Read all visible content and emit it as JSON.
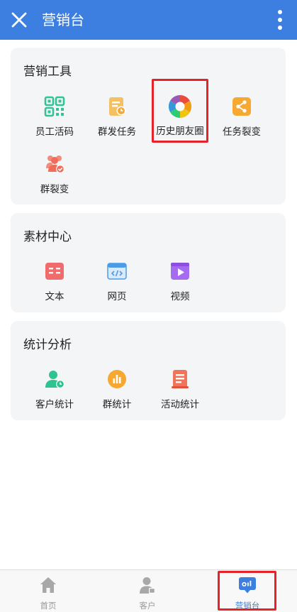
{
  "header": {
    "title": "营销台",
    "close_icon": "close-icon",
    "more_icon": "more-vertical-icon"
  },
  "sections": [
    {
      "title": "营销工具",
      "items": [
        {
          "label": "员工活码",
          "icon": "qr-code-icon"
        },
        {
          "label": "群发任务",
          "icon": "mass-send-task-icon"
        },
        {
          "label": "历史朋友圈",
          "icon": "moments-aperture-icon"
        },
        {
          "label": "任务裂变",
          "icon": "share-icon"
        },
        {
          "label": "群裂变",
          "icon": "group-fission-icon"
        }
      ]
    },
    {
      "title": "素材中心",
      "items": [
        {
          "label": "文本",
          "icon": "text-icon"
        },
        {
          "label": "网页",
          "icon": "webpage-code-icon"
        },
        {
          "label": "视频",
          "icon": "video-play-icon"
        }
      ]
    },
    {
      "title": "统计分析",
      "items": [
        {
          "label": "客户统计",
          "icon": "customer-stats-icon"
        },
        {
          "label": "群统计",
          "icon": "group-stats-icon"
        },
        {
          "label": "活动统计",
          "icon": "activity-stats-icon"
        }
      ]
    }
  ],
  "tabbar": {
    "tabs": [
      {
        "label": "首页",
        "icon": "home-icon",
        "active": false
      },
      {
        "label": "客户",
        "icon": "customer-icon",
        "active": false
      },
      {
        "label": "营销台",
        "icon": "marketing-icon",
        "active": true
      }
    ]
  },
  "colors": {
    "primary": "#3d7fe0",
    "highlight": "#e6222a",
    "card_bg": "#f4f5f7"
  }
}
